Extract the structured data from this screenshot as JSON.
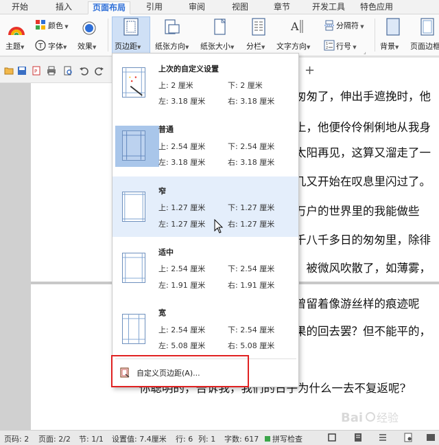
{
  "tabs": [
    {
      "label": "开始",
      "active": false
    },
    {
      "label": "插入",
      "active": false
    },
    {
      "label": "页面布局",
      "active": true
    },
    {
      "label": "引用",
      "active": false
    },
    {
      "label": "审阅",
      "active": false
    },
    {
      "label": "视图",
      "active": false
    },
    {
      "label": "章节",
      "active": false
    },
    {
      "label": "开发工具",
      "active": false
    },
    {
      "label": "特色应用",
      "active": false
    }
  ],
  "ribbon": {
    "theme": "主题",
    "color": "颜色",
    "font": "字体",
    "effect": "效果",
    "margins": "页边距",
    "orientation": "纸张方向",
    "size": "纸张大小",
    "columns": "分栏",
    "text_direction": "文字方向",
    "breaks": "分隔符",
    "line_numbers": "行号",
    "background": "背景",
    "page_border": "页面边框"
  },
  "margin_menu": {
    "presets": [
      {
        "title": "上次的自定义设置",
        "top": "上: 2 厘米",
        "bottom": "下: 2 厘米",
        "left": "左: 3.18 厘米",
        "right": "右: 3.18 厘米",
        "selected": false,
        "hover": false
      },
      {
        "title": "普通",
        "top": "上: 2.54 厘米",
        "bottom": "下: 2.54 厘米",
        "left": "左: 3.18 厘米",
        "right": "右: 3.18 厘米",
        "selected": true,
        "hover": false
      },
      {
        "title": "窄",
        "top": "上: 1.27 厘米",
        "bottom": "下: 1.27 厘米",
        "left": "左: 1.27 厘米",
        "right": "右: 1.27 厘米",
        "selected": false,
        "hover": true
      },
      {
        "title": "适中",
        "top": "上: 2.54 厘米",
        "bottom": "下: 2.54 厘米",
        "left": "左: 1.91 厘米",
        "right": "右: 1.91 厘米",
        "selected": false,
        "hover": false
      },
      {
        "title": "宽",
        "top": "上: 2.54 厘米",
        "bottom": "下: 2.54 厘米",
        "left": "左: 5.08 厘米",
        "right": "右: 5.08 厘米",
        "selected": false,
        "hover": false
      }
    ],
    "custom_label": "自定义页边距(A)..."
  },
  "document": {
    "lines": [
      "匆匆了，伸出手遮挽时，他",
      "上，他便伶伶俐俐地从我身",
      "太阳再见，这算又溜走了一",
      "几又开始在叹息里闪过了。",
      "万户的世界里的我能做些",
      "千八千多日的匆匆里，除徘",
      "，被微风吹散了，如薄雾，",
      "曾留着像游丝样的痕迹呢",
      "果的回去罢？但不能平的，",
      "你聪明的，告诉我，我们的日子为什么一去不复返呢?"
    ]
  },
  "status": {
    "page_code": "页码: 2",
    "page": "页面: 2/2",
    "section": "节: 1/1",
    "setting": "设置值: 7.4厘米",
    "row": "行: 6",
    "col": "列: 1",
    "words": "字数: 617",
    "spell": "拼写检查"
  },
  "watermark": {
    "text": "Bai百经验"
  },
  "colors": {
    "accent": "#2e6fd8",
    "highlight_box": "#e02020",
    "menu_hover": "#e4eefb",
    "selected_thumb": "#a9c6ea"
  }
}
